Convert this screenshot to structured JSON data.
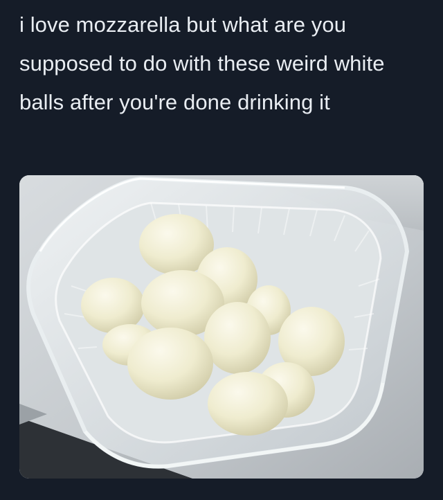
{
  "post": {
    "text": "i love mozzarella but what are you supposed to do with these weird white balls after you're done drinking it"
  },
  "media": {
    "subject": "plastic tub of fresh mozzarella balls on a windowsill",
    "icon": "photo"
  },
  "colors": {
    "background": "#151c28",
    "text": "#e9edf2"
  }
}
